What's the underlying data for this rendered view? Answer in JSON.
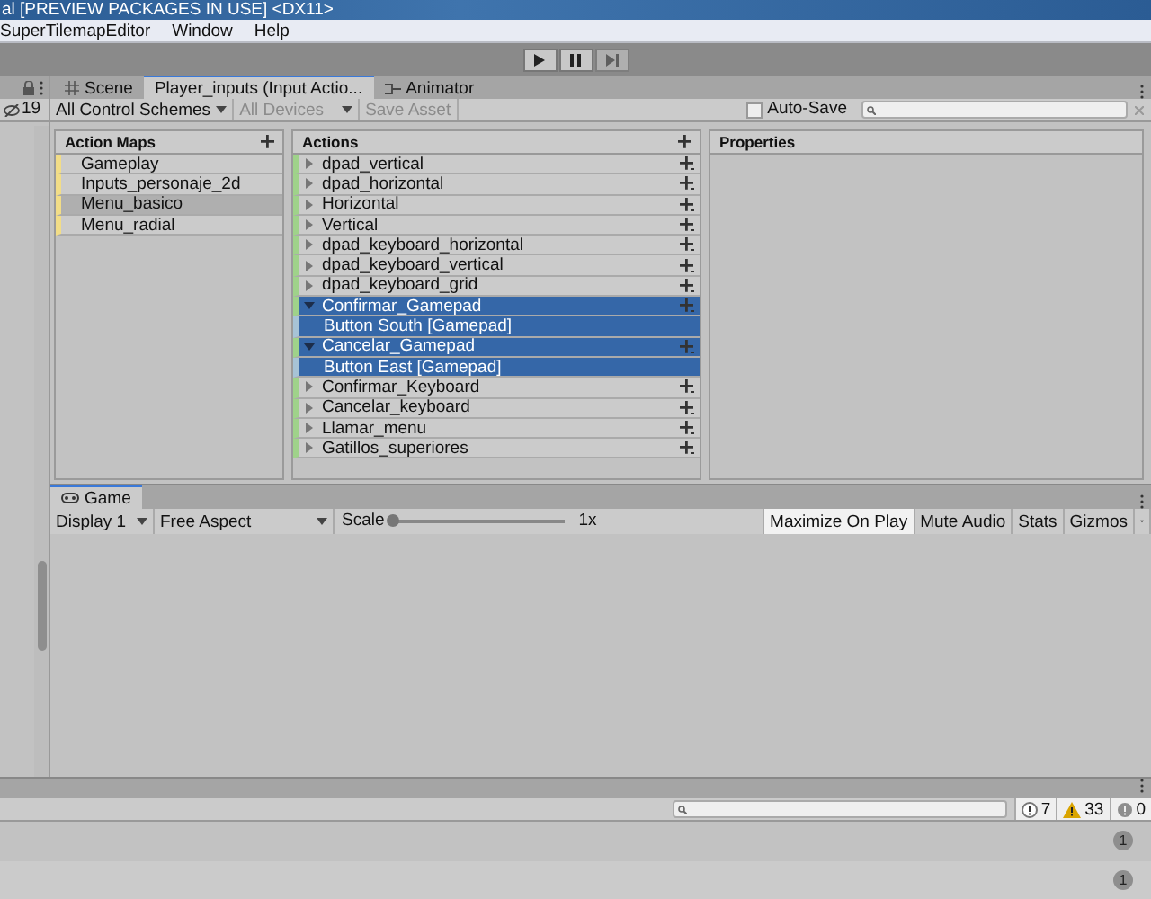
{
  "window": {
    "title": "al [PREVIEW PACKAGES IN USE] <DX11>"
  },
  "menu": [
    "SuperTilemapEditor",
    "Window",
    "Help"
  ],
  "hierarchy": {
    "hidden_count": "19"
  },
  "editor_tabs": [
    {
      "label": "Scene",
      "kind": "scene",
      "selected": false
    },
    {
      "label": "Player_inputs (Input Actio...",
      "kind": "plain",
      "selected": true
    },
    {
      "label": "Animator",
      "kind": "animator",
      "selected": false
    }
  ],
  "toolbar": {
    "control_schemes": "All Control Schemes",
    "devices": {
      "label": "All Devices",
      "disabled": true
    },
    "save_asset": {
      "label": "Save Asset",
      "disabled": true
    },
    "auto_save": {
      "label": "Auto-Save",
      "checked": false
    }
  },
  "action_maps": {
    "title": "Action Maps",
    "items": [
      {
        "label": "Gameplay",
        "selected": false
      },
      {
        "label": "Inputs_personaje_2d",
        "selected": false
      },
      {
        "label": "Menu_basico",
        "selected": true
      },
      {
        "label": "Menu_radial",
        "selected": false
      }
    ]
  },
  "actions": {
    "title": "Actions",
    "items": [
      {
        "label": "dpad_vertical",
        "expanded": false,
        "selected": false
      },
      {
        "label": "dpad_horizontal",
        "expanded": false,
        "selected": false
      },
      {
        "label": "Horizontal",
        "expanded": false,
        "selected": false
      },
      {
        "label": "Vertical",
        "expanded": false,
        "selected": false
      },
      {
        "label": "dpad_keyboard_horizontal",
        "expanded": false,
        "selected": false
      },
      {
        "label": "dpad_keyboard_vertical",
        "expanded": false,
        "selected": false
      },
      {
        "label": "dpad_keyboard_grid",
        "expanded": false,
        "selected": false
      },
      {
        "label": "Confirmar_Gamepad",
        "expanded": true,
        "selected": true,
        "children": [
          {
            "label": "Button South [Gamepad]",
            "selected": true
          }
        ]
      },
      {
        "label": "Cancelar_Gamepad",
        "expanded": true,
        "selected": true,
        "children": [
          {
            "label": "Button East [Gamepad]",
            "selected": true
          }
        ]
      },
      {
        "label": "Confirmar_Keyboard",
        "expanded": false,
        "selected": false
      },
      {
        "label": "Cancelar_keyboard",
        "expanded": false,
        "selected": false
      },
      {
        "label": "Llamar_menu",
        "expanded": false,
        "selected": false
      },
      {
        "label": "Gatillos_superiores",
        "expanded": false,
        "selected": false
      }
    ]
  },
  "properties": {
    "title": "Properties"
  },
  "game": {
    "tab": "Game",
    "display": "Display 1",
    "aspect": "Free Aspect",
    "scale": {
      "label": "Scale",
      "level": 0.0,
      "reading": "1x"
    },
    "buttons": [
      {
        "label": "Maximize On Play",
        "on": true
      },
      {
        "label": "Mute Audio",
        "on": false
      },
      {
        "label": "Stats",
        "on": false
      },
      {
        "label": "Gizmos",
        "on": false
      }
    ]
  },
  "console": {
    "counts": [
      {
        "kind": "info",
        "value": "7"
      },
      {
        "kind": "warning",
        "value": "33"
      },
      {
        "kind": "error",
        "value": "0"
      }
    ],
    "rows": [
      {
        "count": "1"
      },
      {
        "count": "1"
      }
    ]
  }
}
